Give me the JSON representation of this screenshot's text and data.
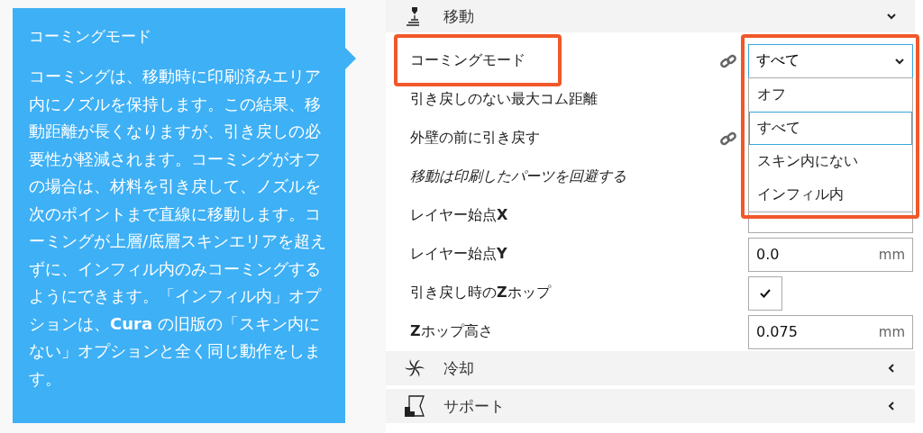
{
  "tooltip": {
    "title": "コーミングモード",
    "body": "コーミングは、移動時に印刷済みエリア内にノズルを保持します。この結果、移動距離が長くなりますが、引き戻しの必要性が軽減されます。コーミングがオフの場合は、材料を引き戻して、ノズルを次のポイントまで直線に移動します。コーミングが上層/底層スキンエリアを超えずに、インフィル内のみコーミングするようにできます。「インフィル内」オプションは、**Cura** の旧版の「スキン内にない」オプションと全く同じ動作をします。"
  },
  "sections": [
    {
      "title": "移動",
      "kind": "travel",
      "expanded": true,
      "settings": [
        {
          "label": "コーミングモード",
          "kind": "dropdown",
          "linked": true,
          "italic": false,
          "highlighted": true,
          "value": "すべて",
          "open": true,
          "options": [
            {
              "label": "オフ",
              "selected": false
            },
            {
              "label": "すべて",
              "selected": true
            },
            {
              "label": "スキン内にない",
              "selected": false
            },
            {
              "label": "インフィル内",
              "selected": false
            }
          ]
        },
        {
          "label": "引き戻しのない最大コム距離",
          "kind": "hidden",
          "linked": false,
          "italic": false,
          "highlighted": false
        },
        {
          "label": "外壁の前に引き戻す",
          "kind": "hidden",
          "linked": true,
          "italic": false,
          "highlighted": false
        },
        {
          "label": "移動は印刷したパーツを回避する",
          "kind": "hidden",
          "linked": false,
          "italic": true,
          "highlighted": false
        },
        {
          "label": "レイヤー始点**X**",
          "kind": "number",
          "linked": false,
          "italic": false,
          "highlighted": false
        },
        {
          "label": "レイヤー始点**Y**",
          "kind": "number",
          "linked": false,
          "italic": false,
          "highlighted": false,
          "value": "0.0",
          "unit": "mm"
        },
        {
          "label": "引き戻し時の**Z**ホップ",
          "kind": "checkbox",
          "linked": false,
          "italic": false,
          "highlighted": false,
          "checked": true
        },
        {
          "label": "**Z**ホップ高さ",
          "kind": "number",
          "linked": false,
          "italic": false,
          "highlighted": false,
          "value": "0.075",
          "unit": "mm"
        }
      ]
    },
    {
      "title": "冷却",
      "kind": "fan",
      "expanded": false
    },
    {
      "title": "サポート",
      "kind": "support",
      "expanded": false
    }
  ]
}
